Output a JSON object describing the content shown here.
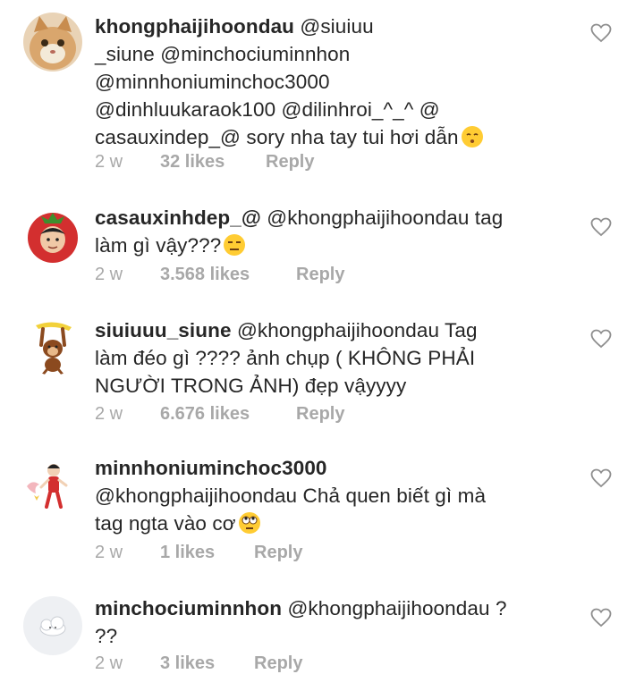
{
  "comments": [
    {
      "username": "khongphaijihoondau",
      "text_lines": [
        "@siuiuu",
        "_siune @minchociuminnhon",
        "@minnhoniuminchoc3000",
        "@dinhluukaraok100 @dilinhroi_^_^ @",
        "casauxindep_@ sory nha tay tui hơi dẫn"
      ],
      "emoji": "kissing-face-emoji",
      "time": "2 w",
      "likes": "32 likes",
      "reply": "Reply"
    },
    {
      "username": "casauxinhdep_@",
      "text_lines": [
        "@khongphaijihoondau tag",
        "làm gì vậy???"
      ],
      "emoji": "unamused-face-emoji",
      "time": "2 w",
      "likes": "3.568 likes",
      "reply": "Reply"
    },
    {
      "username": "siuiuuu_siune",
      "text_lines": [
        "@khongphaijihoondau Tag",
        "làm đéo gì ???? ảnh chụp ( KHÔNG PHẢI",
        "NGƯỜI TRONG ẢNH) đẹp vậyyyy"
      ],
      "emoji": "",
      "time": "2 w",
      "likes": "6.676 likes",
      "reply": "Reply"
    },
    {
      "username": "minnhoniuminchoc3000",
      "text_lines": [
        "",
        "@khongphaijihoondau Chả quen biết gì mà",
        "tag ngta vào cơ"
      ],
      "emoji": "rolling-eyes-face-emoji",
      "time": "2 w",
      "likes": "1 likes",
      "reply": "Reply"
    },
    {
      "username": "minchociuminnhon",
      "text_lines": [
        "@khongphaijihoondau ?",
        "??"
      ],
      "emoji": "",
      "time": "2 w",
      "likes": "3 likes",
      "reply": "Reply"
    }
  ],
  "colors": {
    "text": "#262626",
    "meta": "#a8a8a8",
    "heart": "#8e8e8e",
    "background": "#ffffff"
  }
}
